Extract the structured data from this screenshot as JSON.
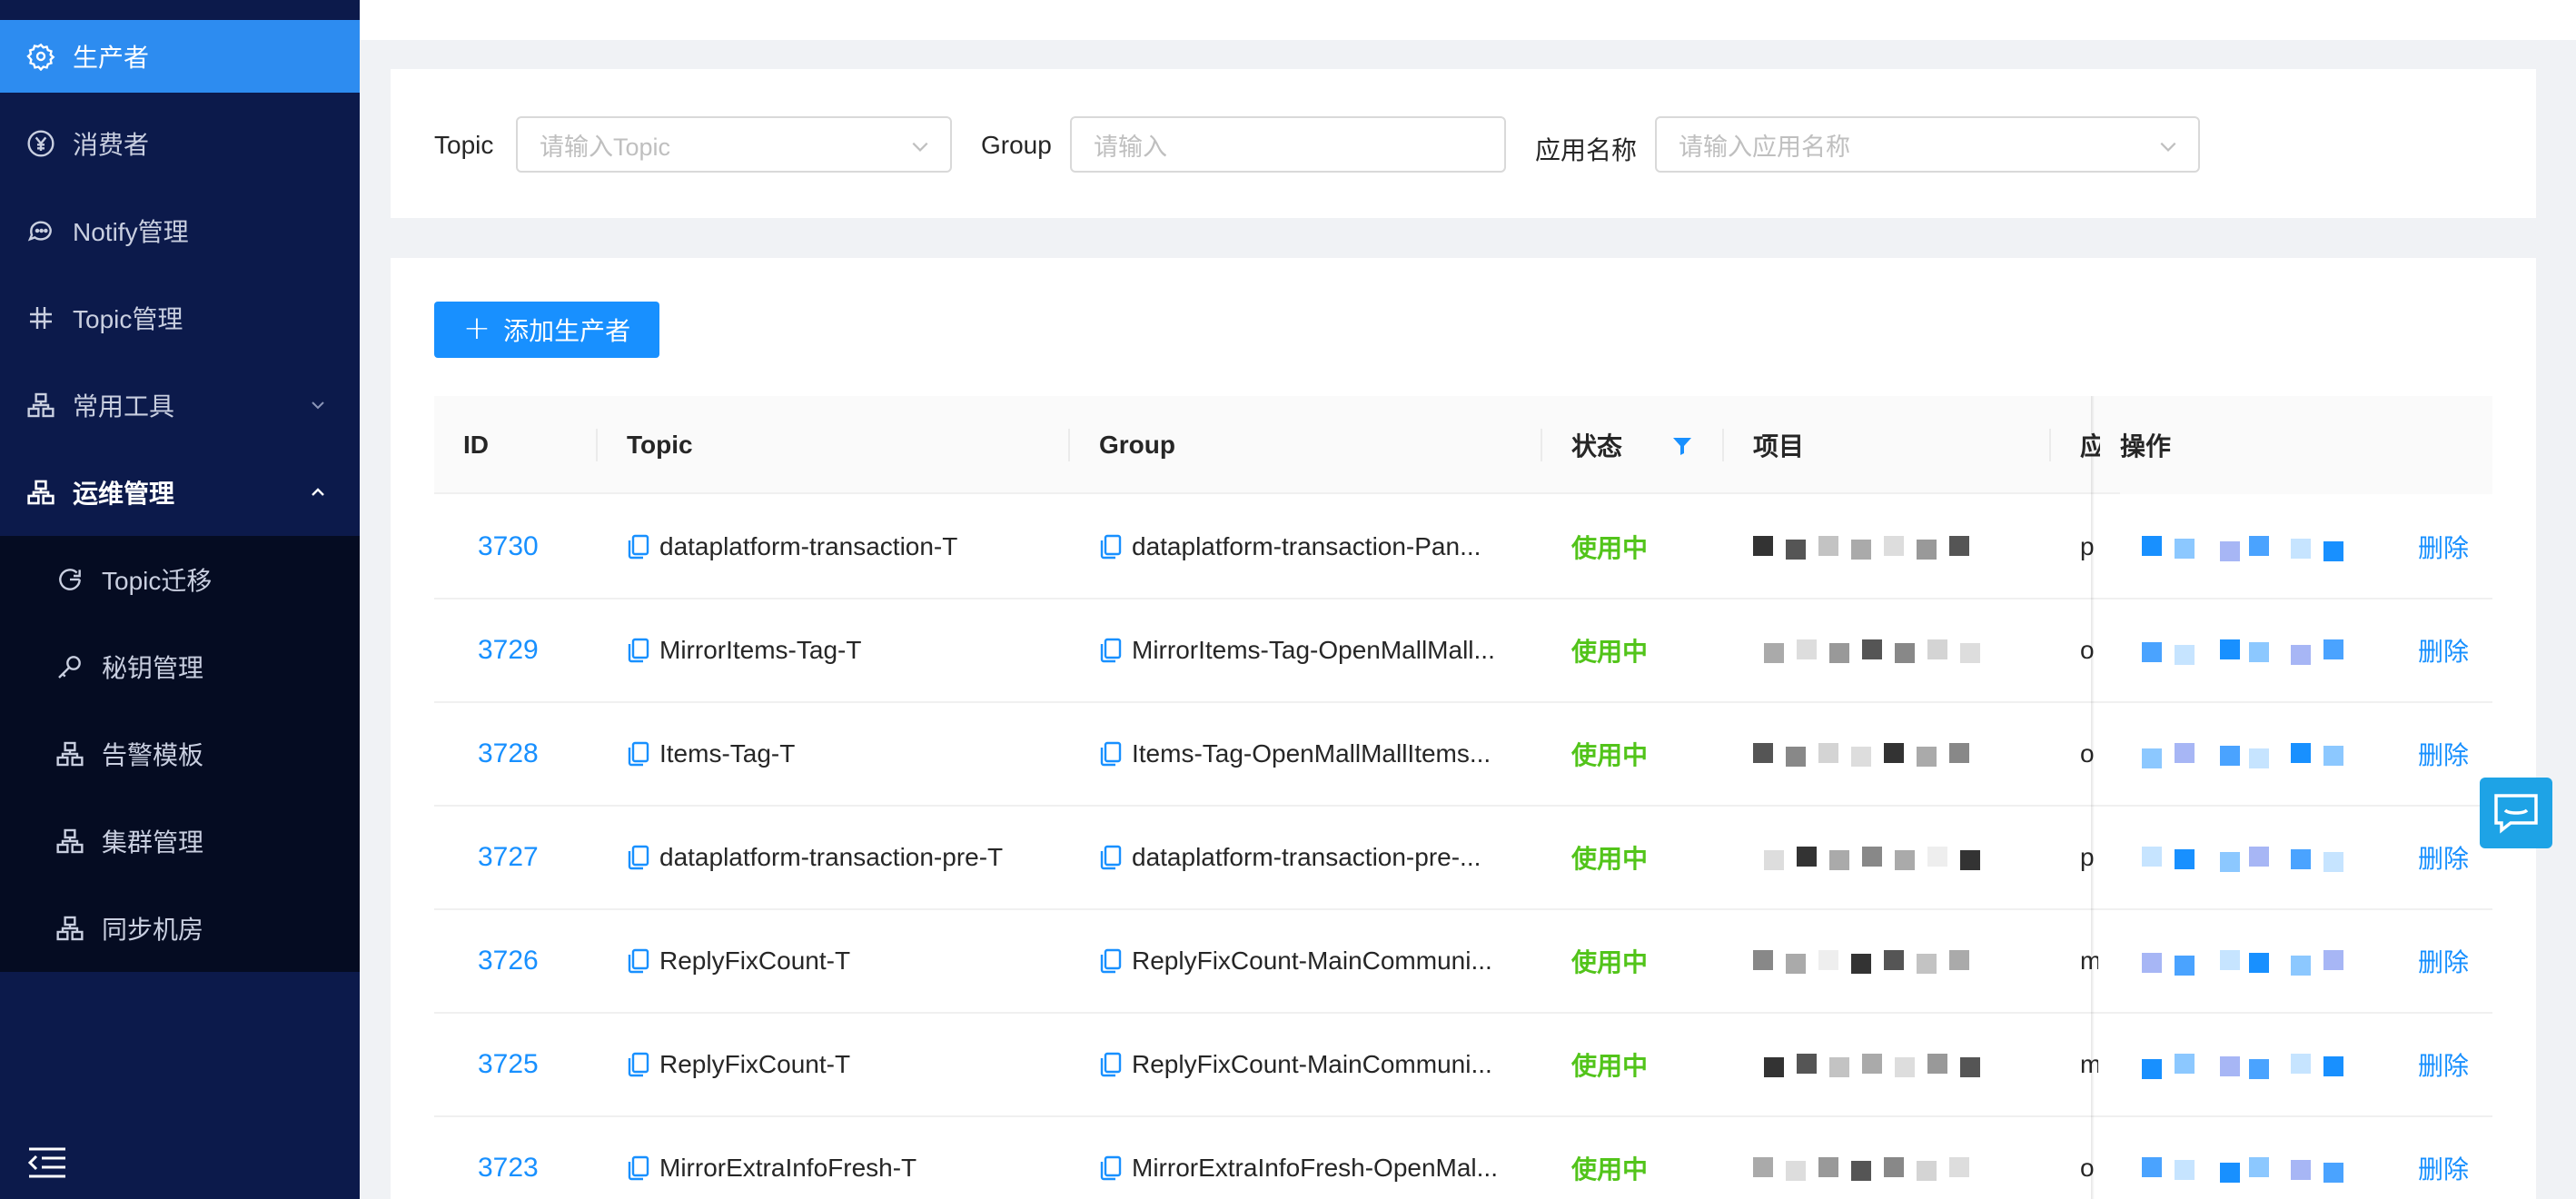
{
  "sidebar": {
    "items": [
      {
        "label": "生产者",
        "icon": "gear-icon"
      },
      {
        "label": "消费者",
        "icon": "yen-circle-icon"
      },
      {
        "label": "Notify管理",
        "icon": "chat-bubbles-icon"
      },
      {
        "label": "Topic管理",
        "icon": "hash-icon"
      },
      {
        "label": "常用工具",
        "icon": "cluster-icon"
      },
      {
        "label": "运维管理",
        "icon": "cluster-icon"
      }
    ],
    "sub_items": [
      {
        "label": "Topic迁移",
        "icon": "migrate-icon"
      },
      {
        "label": "秘钥管理",
        "icon": "key-icon"
      },
      {
        "label": "告警模板",
        "icon": "cluster-icon"
      },
      {
        "label": "集群管理",
        "icon": "cluster-icon"
      },
      {
        "label": "同步机房",
        "icon": "cluster-icon"
      }
    ]
  },
  "filters": {
    "topic_label": "Topic",
    "topic_placeholder": "请输入Topic",
    "group_label": "Group",
    "group_placeholder": "请输入",
    "app_label": "应用名称",
    "app_placeholder": "请输入应用名称"
  },
  "add_button": "添加生产者",
  "table": {
    "columns": {
      "id": "ID",
      "topic": "Topic",
      "group": "Group",
      "status": "状态",
      "project": "项目",
      "app": "应",
      "ops": "操作"
    },
    "rows": [
      {
        "id": "3730",
        "topic": "dataplatform-transaction-T",
        "group": "dataplatform-transaction-Pan...",
        "status": "使用中",
        "app": "p",
        "action": "删除"
      },
      {
        "id": "3729",
        "topic": "MirrorItems-Tag-T",
        "group": "MirrorItems-Tag-OpenMallMall...",
        "status": "使用中",
        "app": "o",
        "action": "删除"
      },
      {
        "id": "3728",
        "topic": "Items-Tag-T",
        "group": "Items-Tag-OpenMallMallItems...",
        "status": "使用中",
        "app": "o",
        "action": "删除"
      },
      {
        "id": "3727",
        "topic": "dataplatform-transaction-pre-T",
        "group": "dataplatform-transaction-pre-...",
        "status": "使用中",
        "app": "p",
        "action": "删除"
      },
      {
        "id": "3726",
        "topic": "ReplyFixCount-T",
        "group": "ReplyFixCount-MainCommuni...",
        "status": "使用中",
        "app": "m",
        "action": "删除"
      },
      {
        "id": "3725",
        "topic": "ReplyFixCount-T",
        "group": "ReplyFixCount-MainCommuni...",
        "status": "使用中",
        "app": "m",
        "action": "删除"
      },
      {
        "id": "3723",
        "topic": "MirrorExtraInfoFresh-T",
        "group": "MirrorExtraInfoFresh-OpenMal...",
        "status": "使用中",
        "app": "o",
        "action": "删除"
      }
    ]
  },
  "colors": {
    "sidebar_bg": "#0c1a4b",
    "submenu_bg": "#050c22",
    "active_item": "#2d8cf0",
    "primary": "#1890ff",
    "status_green": "#52c41a"
  }
}
